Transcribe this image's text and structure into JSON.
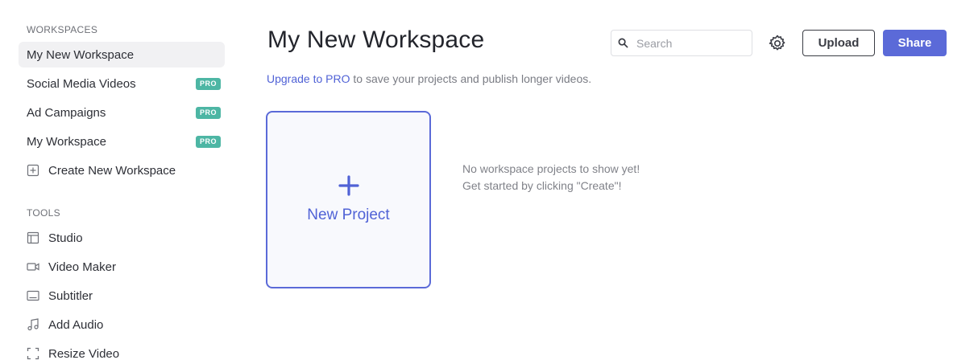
{
  "sidebar": {
    "workspaces_title": "WORKSPACES",
    "workspaces": [
      {
        "label": "My New Workspace",
        "active": true,
        "badge": ""
      },
      {
        "label": "Social Media Videos",
        "active": false,
        "badge": "PRO"
      },
      {
        "label": "Ad Campaigns",
        "active": false,
        "badge": "PRO"
      },
      {
        "label": "My Workspace",
        "active": false,
        "badge": "PRO"
      }
    ],
    "create_workspace": {
      "label": "Create New Workspace",
      "icon": "plus-square-icon"
    },
    "tools_title": "TOOLS",
    "tools": [
      {
        "label": "Studio",
        "icon": "layout-icon"
      },
      {
        "label": "Video Maker",
        "icon": "video-camera-icon"
      },
      {
        "label": "Subtitler",
        "icon": "subtitles-icon"
      },
      {
        "label": "Add Audio",
        "icon": "music-note-icon"
      },
      {
        "label": "Resize Video",
        "icon": "resize-frame-icon"
      }
    ]
  },
  "header": {
    "title": "My New Workspace",
    "search_placeholder": "Search",
    "search_value": "",
    "upload_label": "Upload",
    "share_label": "Share"
  },
  "upgrade": {
    "link_text": "Upgrade to PRO",
    "rest_text": " to save your projects and publish longer videos."
  },
  "new_project": {
    "label": "New Project"
  },
  "empty_state": {
    "line1": "No workspace projects to show yet!",
    "line2": "Get started by clicking \"Create\"!"
  },
  "colors": {
    "accent": "#5b6ad8",
    "pro_badge": "#4db6a4",
    "active_item_bg": "#f1f1f3"
  }
}
